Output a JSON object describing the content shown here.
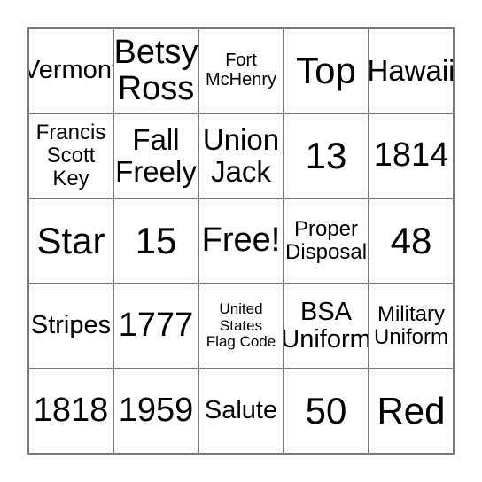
{
  "card": {
    "type": "bingo-card",
    "columns": 5,
    "rows": 5,
    "colors": {
      "background": "#ffffff",
      "grid_line": "#777777",
      "text": "#000000"
    },
    "free_space": {
      "row": 2,
      "column": 2,
      "label": "Free!"
    },
    "cells": [
      [
        {
          "text": "Vermont",
          "size": "md",
          "lines": 1
        },
        {
          "text": "Betsy\nRoss",
          "size": "xl",
          "lines": 2
        },
        {
          "text": "Fort\nMcHenry",
          "size": "xs",
          "lines": 2
        },
        {
          "text": "Top",
          "size": "xxl",
          "lines": 1
        },
        {
          "text": "Hawaii",
          "size": "lg",
          "lines": 1
        }
      ],
      [
        {
          "text": "Francis\nScott\nKey",
          "size": "sm",
          "lines": 3
        },
        {
          "text": "Fall\nFreely",
          "size": "lg",
          "lines": 2
        },
        {
          "text": "Union\nJack",
          "size": "lg",
          "lines": 2
        },
        {
          "text": "13",
          "size": "xxl",
          "lines": 1
        },
        {
          "text": "1814",
          "size": "xl",
          "lines": 1
        }
      ],
      [
        {
          "text": "Star",
          "size": "xxl",
          "lines": 1
        },
        {
          "text": "15",
          "size": "xxl",
          "lines": 1
        },
        {
          "text": "Free!",
          "size": "xl",
          "lines": 1
        },
        {
          "text": "Proper\nDisposal",
          "size": "sm",
          "lines": 2
        },
        {
          "text": "48",
          "size": "xxl",
          "lines": 1
        }
      ],
      [
        {
          "text": "Stripes",
          "size": "md",
          "lines": 1
        },
        {
          "text": "1777",
          "size": "xl",
          "lines": 1
        },
        {
          "text": "United\nStates\nFlag Code",
          "size": "xxs",
          "lines": 3
        },
        {
          "text": "BSA\nUniform",
          "size": "md",
          "lines": 2
        },
        {
          "text": "Military\nUniform",
          "size": "sm",
          "lines": 2
        }
      ],
      [
        {
          "text": "1818",
          "size": "xl",
          "lines": 1
        },
        {
          "text": "1959",
          "size": "xl",
          "lines": 1
        },
        {
          "text": "Salute",
          "size": "md",
          "lines": 1
        },
        {
          "text": "50",
          "size": "xxl",
          "lines": 1
        },
        {
          "text": "Red",
          "size": "xxl",
          "lines": 1
        }
      ]
    ]
  }
}
